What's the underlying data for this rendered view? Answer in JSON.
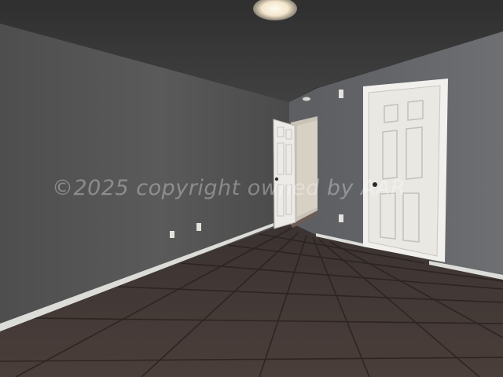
{
  "image": {
    "description_visible_text": "©2025 copyright owned by AAR",
    "watermark_text": "©2025 copyright owned by AAR"
  },
  "colors": {
    "ceiling": "#3a3a3a",
    "left_wall": "#545454",
    "back_wall": "#5f6063",
    "right_wall": "#6a6c70",
    "floor": "#3f3532",
    "grout": "#2b2320",
    "baseboard": "#dcdcd8",
    "door": "#ecebe7",
    "hall_wall": "#cfc9bf",
    "light": "#fff6e6"
  }
}
